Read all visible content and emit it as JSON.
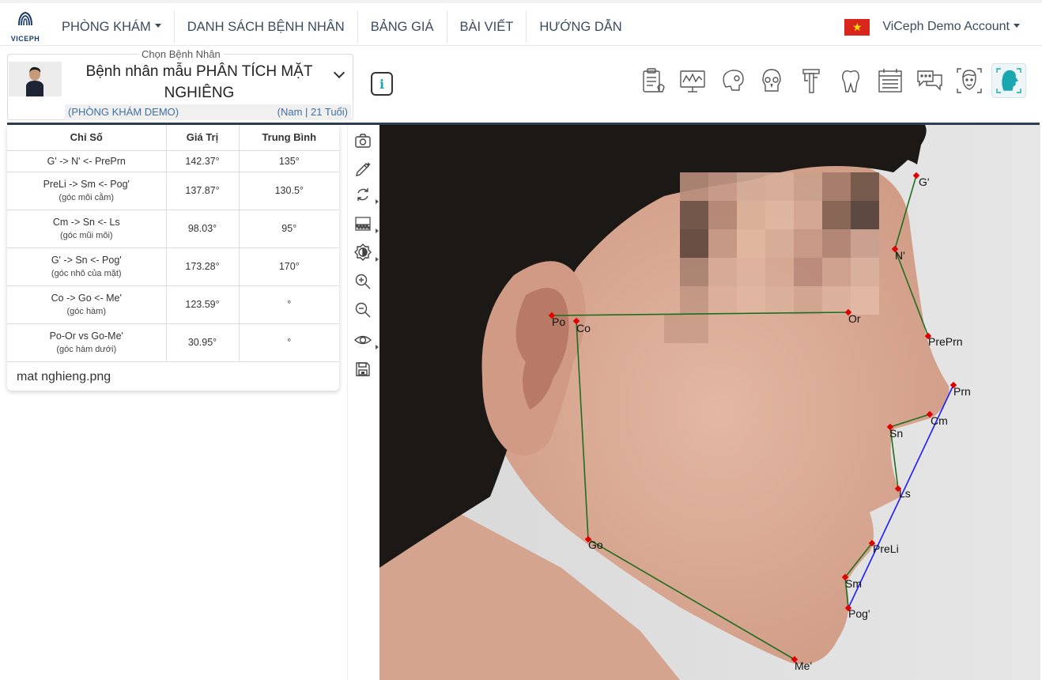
{
  "brand": {
    "logo_text": "VICEPH"
  },
  "nav": {
    "items": [
      {
        "label": "PHÒNG KHÁM",
        "dropdown": true
      },
      {
        "label": "DANH SÁCH BỆNH NHÂN",
        "dropdown": false
      },
      {
        "label": "BẢNG GIÁ",
        "dropdown": false
      },
      {
        "label": "BÀI VIẾT",
        "dropdown": false
      },
      {
        "label": "HƯỚNG DẪN",
        "dropdown": false
      }
    ]
  },
  "account": {
    "flag_star": "★",
    "name": "ViCeph Demo Account"
  },
  "patient": {
    "legend": "Chọn Bệnh Nhân",
    "name": "Bệnh nhân mẫu PHÂN TÍCH MẶT NGHIÊNG",
    "clinic": "(PHÒNG KHÁM DEMO)",
    "info": "(Nam | 21 Tuổi)"
  },
  "info_button": "i",
  "colors": {
    "accent": "#1aa7b0",
    "divider": "#2d3e50",
    "landmark": "#e00000",
    "line_green": "#1f6e1f",
    "line_blue": "#1a1aff"
  },
  "toolbar_icons": [
    "clipboard-icon",
    "monitor-chart-icon",
    "skull-side-icon",
    "skull-front-icon",
    "caliper-icon",
    "tooth-icon",
    "calendar-icon",
    "chat-icon",
    "face-scan-icon",
    "face-profile-icon"
  ],
  "table": {
    "headers": [
      "Chỉ Số",
      "Giá Trị",
      "Trung Bình"
    ],
    "rows": [
      {
        "name": "G' -> N' <- PrePrn",
        "sub": "",
        "value": "142.37°",
        "mean": "135°"
      },
      {
        "name": "PreLi -> Sm <- Pog'",
        "sub": "(góc môi cằm)",
        "value": "137.87°",
        "mean": "130.5°"
      },
      {
        "name": "Cm -> Sn <- Ls",
        "sub": "(góc mũi môi)",
        "value": "98.03°",
        "mean": "95°"
      },
      {
        "name": "G' -> Sn <- Pog'",
        "sub": "(góc nhô của mặt)",
        "value": "173.28°",
        "mean": "170°"
      },
      {
        "name": "Co -> Go <- Me'",
        "sub": "(góc hàm)",
        "value": "123.59°",
        "mean": "°"
      },
      {
        "name": "Po-Or vs Go-Me'",
        "sub": "(góc hàm dưới)",
        "value": "30.95°",
        "mean": "°"
      }
    ],
    "filename": "mat nghieng.png"
  },
  "side_tools": [
    "camera-icon",
    "pen-icon",
    "rotate-icon",
    "contrast-grid-icon",
    "brightness-icon",
    "zoom-in-icon",
    "zoom-out-icon",
    "eye-icon",
    "save-icon"
  ],
  "landmarks": {
    "gp": "G'",
    "np": "N'",
    "preprn": "PrePrn",
    "prn": "Prn",
    "cm": "Cm",
    "sn": "Sn",
    "ls": "Ls",
    "preli": "PreLi",
    "sm": "Sm",
    "pogp": "Pog'",
    "mep": "Me'",
    "go": "Go",
    "co": "Co",
    "po": "Po",
    "or": "Or"
  }
}
